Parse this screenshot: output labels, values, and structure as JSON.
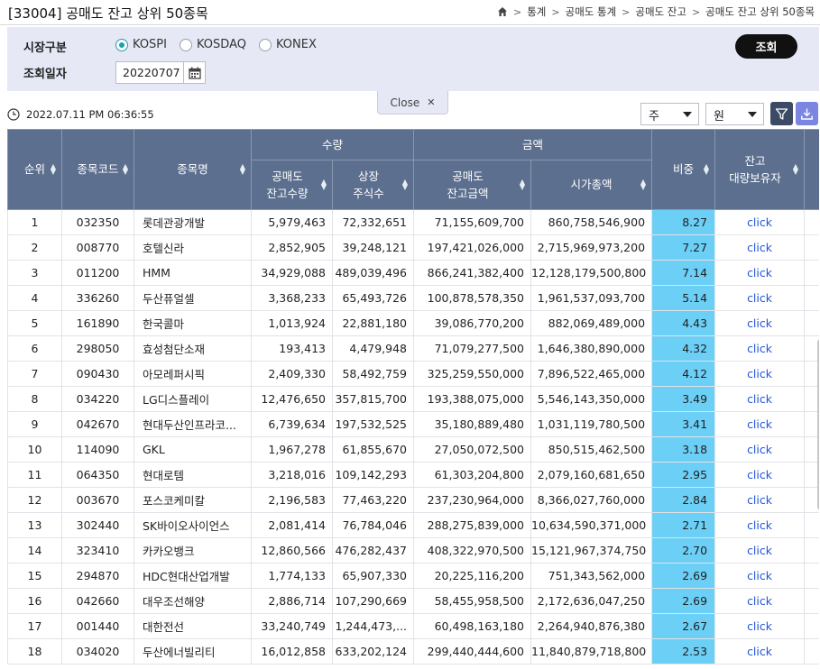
{
  "title": "[33004] 공매도 잔고 상위 50종목",
  "breadcrumb": [
    "통계",
    "공매도 통계",
    "공매도 잔고",
    "공매도 잔고 상위 50종목"
  ],
  "search": {
    "market_label": "시장구분",
    "markets": [
      {
        "label": "KOSPI",
        "selected": true
      },
      {
        "label": "KOSDAQ",
        "selected": false
      },
      {
        "label": "KONEX",
        "selected": false
      }
    ],
    "date_label": "조회일자",
    "date_value": "20220707",
    "search_button": "조회",
    "close_label": "Close"
  },
  "toolbar": {
    "timestamp": "2022.07.11 PM 06:36:55",
    "unit_share": "주",
    "unit_money": "원"
  },
  "table": {
    "headers": {
      "rank": "순위",
      "code": "종목코드",
      "name": "종목명",
      "qty_group": "수량",
      "qty_short": "공매도\n잔고수량",
      "qty_listed": "상장\n주식수",
      "amt_group": "금액",
      "amt_short": "공매도\n잔고금액",
      "amt_cap": "시가총액",
      "ratio": "비중",
      "holder": "잔고\n대량보유자"
    },
    "rows": [
      {
        "rank": "1",
        "code": "032350",
        "name": "롯데관광개발",
        "short_qty": "5,979,463",
        "listed": "72,332,651",
        "short_amt": "71,155,609,700",
        "cap": "860,758,546,900",
        "ratio": "8.27",
        "link": "click"
      },
      {
        "rank": "2",
        "code": "008770",
        "name": "호텔신라",
        "short_qty": "2,852,905",
        "listed": "39,248,121",
        "short_amt": "197,421,026,000",
        "cap": "2,715,969,973,200",
        "ratio": "7.27",
        "link": "click"
      },
      {
        "rank": "3",
        "code": "011200",
        "name": "HMM",
        "short_qty": "34,929,088",
        "listed": "489,039,496",
        "short_amt": "866,241,382,400",
        "cap": "12,128,179,500,800",
        "ratio": "7.14",
        "link": "click"
      },
      {
        "rank": "4",
        "code": "336260",
        "name": "두산퓨얼셀",
        "short_qty": "3,368,233",
        "listed": "65,493,726",
        "short_amt": "100,878,578,350",
        "cap": "1,961,537,093,700",
        "ratio": "5.14",
        "link": "click"
      },
      {
        "rank": "5",
        "code": "161890",
        "name": "한국콜마",
        "short_qty": "1,013,924",
        "listed": "22,881,180",
        "short_amt": "39,086,770,200",
        "cap": "882,069,489,000",
        "ratio": "4.43",
        "link": "click"
      },
      {
        "rank": "6",
        "code": "298050",
        "name": "효성첨단소재",
        "short_qty": "193,413",
        "listed": "4,479,948",
        "short_amt": "71,079,277,500",
        "cap": "1,646,380,890,000",
        "ratio": "4.32",
        "link": "click"
      },
      {
        "rank": "7",
        "code": "090430",
        "name": "아모레퍼시픽",
        "short_qty": "2,409,330",
        "listed": "58,492,759",
        "short_amt": "325,259,550,000",
        "cap": "7,896,522,465,000",
        "ratio": "4.12",
        "link": "click"
      },
      {
        "rank": "8",
        "code": "034220",
        "name": "LG디스플레이",
        "short_qty": "12,476,650",
        "listed": "357,815,700",
        "short_amt": "193,388,075,000",
        "cap": "5,546,143,350,000",
        "ratio": "3.49",
        "link": "click"
      },
      {
        "rank": "9",
        "code": "042670",
        "name": "현대두산인프라코...",
        "short_qty": "6,739,634",
        "listed": "197,532,525",
        "short_amt": "35,180,889,480",
        "cap": "1,031,119,780,500",
        "ratio": "3.41",
        "link": "click"
      },
      {
        "rank": "10",
        "code": "114090",
        "name": "GKL",
        "short_qty": "1,967,278",
        "listed": "61,855,670",
        "short_amt": "27,050,072,500",
        "cap": "850,515,462,500",
        "ratio": "3.18",
        "link": "click"
      },
      {
        "rank": "11",
        "code": "064350",
        "name": "현대로템",
        "short_qty": "3,218,016",
        "listed": "109,142,293",
        "short_amt": "61,303,204,800",
        "cap": "2,079,160,681,650",
        "ratio": "2.95",
        "link": "click"
      },
      {
        "rank": "12",
        "code": "003670",
        "name": "포스코케미칼",
        "short_qty": "2,196,583",
        "listed": "77,463,220",
        "short_amt": "237,230,964,000",
        "cap": "8,366,027,760,000",
        "ratio": "2.84",
        "link": "click"
      },
      {
        "rank": "13",
        "code": "302440",
        "name": "SK바이오사이언스",
        "short_qty": "2,081,414",
        "listed": "76,784,046",
        "short_amt": "288,275,839,000",
        "cap": "10,634,590,371,000",
        "ratio": "2.71",
        "link": "click"
      },
      {
        "rank": "14",
        "code": "323410",
        "name": "카카오뱅크",
        "short_qty": "12,860,566",
        "listed": "476,282,437",
        "short_amt": "408,322,970,500",
        "cap": "15,121,967,374,750",
        "ratio": "2.70",
        "link": "click"
      },
      {
        "rank": "15",
        "code": "294870",
        "name": "HDC현대산업개발",
        "short_qty": "1,774,133",
        "listed": "65,907,330",
        "short_amt": "20,225,116,200",
        "cap": "751,343,562,000",
        "ratio": "2.69",
        "link": "click"
      },
      {
        "rank": "16",
        "code": "042660",
        "name": "대우조선해양",
        "short_qty": "2,886,714",
        "listed": "107,290,669",
        "short_amt": "58,455,958,500",
        "cap": "2,172,636,047,250",
        "ratio": "2.69",
        "link": "click"
      },
      {
        "rank": "17",
        "code": "001440",
        "name": "대한전선",
        "short_qty": "33,240,749",
        "listed": "1,244,473,...",
        "short_amt": "60,498,163,180",
        "cap": "2,264,940,876,380",
        "ratio": "2.67",
        "link": "click"
      },
      {
        "rank": "18",
        "code": "034020",
        "name": "두산에너빌리티",
        "short_qty": "16,012,858",
        "listed": "633,202,124",
        "short_amt": "299,440,444,600",
        "cap": "11,840,879,718,800",
        "ratio": "2.53",
        "link": "click"
      }
    ]
  },
  "colors": {
    "header_bg": "#5c6f8e",
    "ratio_bg": "#6ccff6",
    "search_bg": "#e6e9f5",
    "link": "#2255dd",
    "filter_btn": "#3c4a66",
    "download_btn": "#7a86e0"
  }
}
